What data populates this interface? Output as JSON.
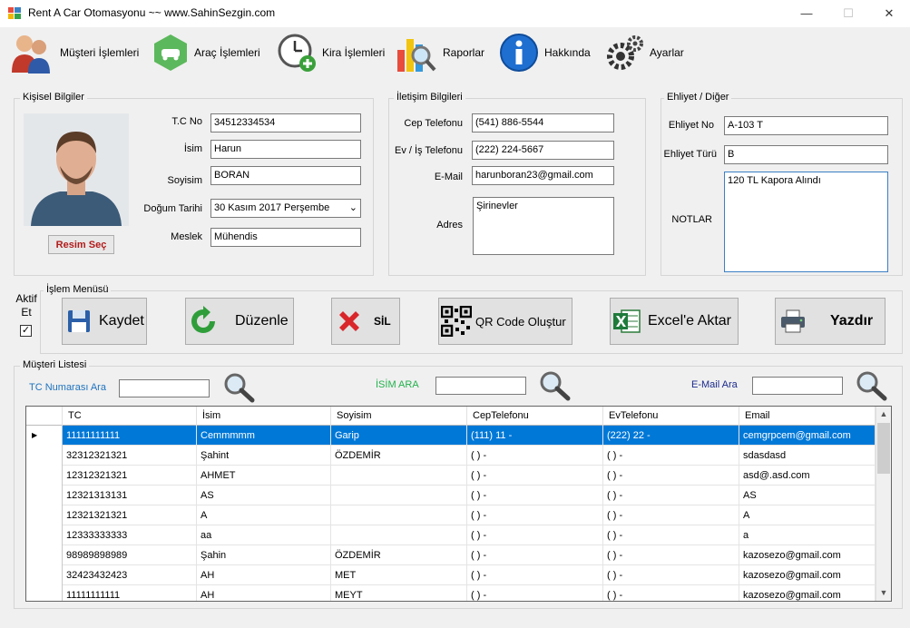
{
  "window": {
    "title": "Rent A Car Otomasyonu ~~ www.SahinSezgin.com"
  },
  "menu": [
    {
      "label": "Müşteri İşlemleri",
      "icon": "users-icon"
    },
    {
      "label": "Araç İşlemleri",
      "icon": "car-icon"
    },
    {
      "label": "Kira İşlemleri",
      "icon": "clock-icon"
    },
    {
      "label": "Raporlar",
      "icon": "report-chart-icon"
    },
    {
      "label": "Hakkında",
      "icon": "info-icon"
    },
    {
      "label": "Ayarlar",
      "icon": "gears-icon"
    }
  ],
  "personal": {
    "title": "Kişisel Bilgiler",
    "tc_label": "T.C No",
    "tc": "34512334534",
    "name_label": "İsim",
    "name": "Harun",
    "surname_label": "Soyisim",
    "surname": "BORAN",
    "birth_label": "Doğum Tarihi",
    "birth": "30   Kasım   2017 Perşembe",
    "job_label": "Meslek",
    "job": "Mühendis",
    "photo_button": "Resim Seç"
  },
  "contact": {
    "title": "İletişim Bilgileri",
    "cell_label": "Cep Telefonu",
    "cell": "(541) 886-5544",
    "home_label": "Ev / İş Telefonu",
    "home": "(222) 224-5667",
    "email_label": "E-Mail",
    "email": "harunboran23@gmail.com",
    "address_label": "Adres",
    "address": "Şirinevler"
  },
  "license": {
    "title": "Ehliyet / Diğer",
    "no_label": "Ehliyet No",
    "no": "A-103 T",
    "type_label": "Ehliyet Türü",
    "type": "B",
    "notes_label": "NOTLAR",
    "notes": "120 TL Kapora Alındı"
  },
  "active": {
    "label": "Aktif Et",
    "checked": true
  },
  "actions": {
    "title": "İşlem Menüsü",
    "save": "Kaydet",
    "edit": "Düzenle",
    "delete": "SİL",
    "qr": "QR Code Oluştur",
    "excel": "Excel'e Aktar",
    "print": "Yazdır"
  },
  "list": {
    "title": "Müşteri Listesi",
    "search_tc_label": "TC Numarası Ara",
    "search_name_label": "İSİM ARA",
    "search_email_label": "E-Mail Ara",
    "columns": [
      "TC",
      "İsim",
      "Soyisim",
      "CepTelefonu",
      "EvTelefonu",
      "Email"
    ],
    "rows": [
      [
        "11111111111",
        "Cemmmmm",
        "Garip",
        "(111) 11 -",
        "(222) 22 -",
        "cemgrpcem@gmail.com"
      ],
      [
        "32312321321",
        "Şahint",
        "ÖZDEMİR",
        "(  )   -",
        "(  )   -",
        "sdasdasd"
      ],
      [
        "12312321321",
        "AHMET",
        "",
        "(  )   -",
        "(  )   -",
        "asd@.asd.com"
      ],
      [
        "12321313131",
        "AS",
        "",
        "(  )   -",
        "(  )   -",
        "AS"
      ],
      [
        "12321321321",
        "A",
        "",
        "(  )   -",
        "(  )   -",
        "A"
      ],
      [
        "12333333333",
        "aa",
        "",
        "(  )   -",
        "(  )   -",
        "a"
      ],
      [
        "98989898989",
        "Şahin",
        "ÖZDEMİR",
        "(  )   -",
        "(  )   -",
        "kazosezo@gmail.com"
      ],
      [
        "32423432423",
        "AH",
        "MET",
        "(  )   -",
        "(  )   -",
        "kazosezo@gmail.com"
      ],
      [
        "11111111111",
        "AH",
        "MEYT",
        "(  )   -",
        "(  )   -",
        "kazosezo@gmail.com"
      ]
    ],
    "selected_row": 0
  },
  "colors": {
    "selection": "#0078d7",
    "tc_label": "#1e73be",
    "name_label": "#22b14c",
    "email_label": "#1b2a8c",
    "photo_button_text": "#b21b1b"
  }
}
